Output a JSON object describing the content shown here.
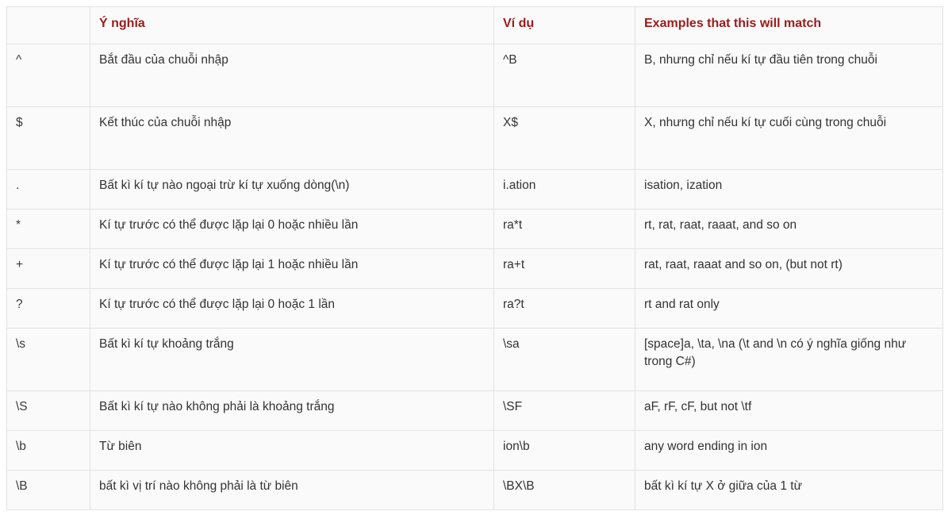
{
  "table": {
    "headers": [
      {
        "label": "",
        "name": "symbol"
      },
      {
        "label": "Ý nghĩa",
        "name": "meaning"
      },
      {
        "label": "Ví dụ",
        "name": "example"
      },
      {
        "label": "Examples that this will match",
        "name": "matches"
      }
    ],
    "rows": [
      {
        "symbol": "^",
        "meaning": "Bắt đầu của chuỗi nhập",
        "example": "^B",
        "matches": "B, nhưng chỉ nếu kí tự đầu tiên trong chuỗi"
      },
      {
        "symbol": "$",
        "meaning": "Kết thúc của chuỗi nhập",
        "example": "X$",
        "matches": "X, nhưng chỉ nếu kí tự cuối cùng trong chuỗi"
      },
      {
        "symbol": ".",
        "meaning": "Bất kì kí tự nào ngoại trừ kí tự xuống dòng(\\n)",
        "example": "i.ation",
        "matches": "isation, ization"
      },
      {
        "symbol": "*",
        "meaning": "Kí tự trước có thể được lặp lại 0 hoặc nhiều lần",
        "example": "ra*t",
        "matches": "rt, rat, raat, raaat, and so on"
      },
      {
        "symbol": "+",
        "meaning": "Kí tự trước có thể được lặp lại 1 hoặc nhiều lần",
        "example": "ra+t",
        "matches": "rat, raat, raaat and so on, (but not rt)"
      },
      {
        "symbol": "?",
        "meaning": "Kí tự trước có thể được lặp lại 0 hoặc 1 lần",
        "example": "ra?t",
        "matches": "rt and rat only"
      },
      {
        "symbol": "\\s",
        "meaning": "Bất kì kí tự khoảng trắng",
        "example": "\\sa",
        "matches": "[space]a, \\ta, \\na (\\t and \\n có ý nghĩa giống như trong C#)"
      },
      {
        "symbol": "\\S",
        "meaning": "Bất kì kí tự nào không phải là khoảng trắng",
        "example": "\\SF",
        "matches": "aF, rF, cF, but not \\tf"
      },
      {
        "symbol": "\\b",
        "meaning": "Từ biên",
        "example": "ion\\b",
        "matches": "any word ending in ion"
      },
      {
        "symbol": "\\B",
        "meaning": "bất kì vị trí nào không phải là từ biên",
        "example": "\\BX\\B",
        "matches": "bất kì kí tự X ở giữa của 1 từ"
      }
    ],
    "row_sizes": [
      "tall",
      "tall",
      "short",
      "short",
      "short",
      "short",
      "tall",
      "short",
      "short",
      "short"
    ]
  },
  "colors": {
    "header_text": "#9c1b1b",
    "body_text": "#333333",
    "border": "#e3e3e3",
    "cell_background": "#fafafa",
    "page_background": "#ffffff"
  }
}
